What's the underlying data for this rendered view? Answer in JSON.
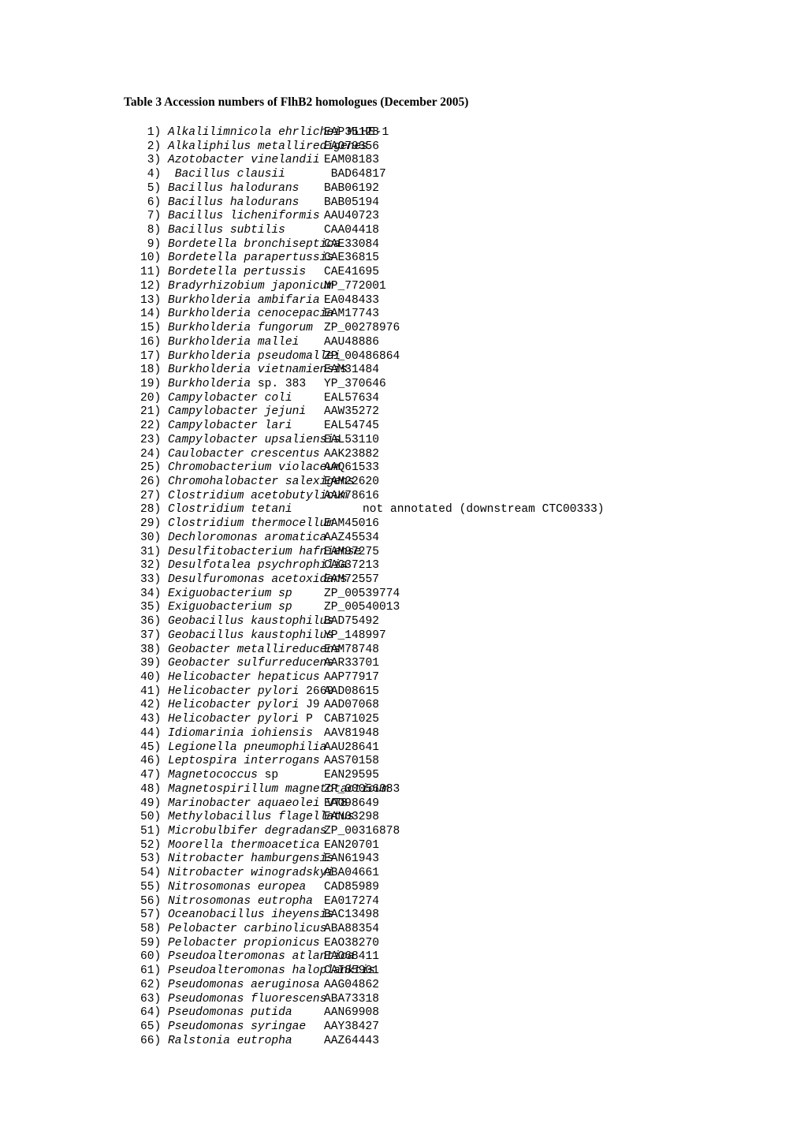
{
  "document": {
    "title": "Table 3 Accession numbers of FlhB2 homologues (December 2005)"
  },
  "table": {
    "entries": [
      {
        "index": "1)",
        "name": "Alkalilimnicola ehrlichei",
        "suffix": " MLHE-1",
        "accession": "EAP35128"
      },
      {
        "index": "2)",
        "name": "Alkaliphilus metalliredigenes",
        "suffix": "",
        "accession": "EAO79356"
      },
      {
        "index": "3)",
        "name": "Azotobacter vinelandii",
        "suffix": "",
        "accession": "EAM08183"
      },
      {
        "index": "4)",
        "name": " Bacillus clausii",
        "suffix": "",
        "accession": " BAD64817"
      },
      {
        "index": "5)",
        "name": "Bacillus halodurans",
        "suffix": "",
        "accession": "BAB06192"
      },
      {
        "index": "6)",
        "name": "Bacillus halodurans",
        "suffix": "",
        "accession": "BAB05194"
      },
      {
        "index": "7)",
        "name": "Bacillus licheniformis",
        "suffix": "",
        "accession": "AAU40723"
      },
      {
        "index": "8)",
        "name": "Bacillus subtilis",
        "suffix": "",
        "accession": "CAA04418"
      },
      {
        "index": "9)",
        "name": "Bordetella bronchiseptica",
        "suffix": "",
        "accession": "CAE33084"
      },
      {
        "index": "10)",
        "name": "Bordetella parapertussis",
        "suffix": "",
        "accession": "CAE36815"
      },
      {
        "index": "11)",
        "name": "Bordetella pertussis",
        "suffix": "",
        "accession": "CAE41695"
      },
      {
        "index": "12)",
        "name": "Bradyrhizobium japonicum",
        "suffix": "",
        "accession": "NP_772001"
      },
      {
        "index": "13)",
        "name": "Burkholderia ambifaria",
        "suffix": "",
        "accession": "EA048433"
      },
      {
        "index": "14)",
        "name": "Burkholderia cenocepacia",
        "suffix": "",
        "accession": "EAM17743"
      },
      {
        "index": "15)",
        "name": "Burkholderia fungorum",
        "suffix": "",
        "accession": "ZP_00278976"
      },
      {
        "index": "16)",
        "name": "Burkholderia mallei",
        "suffix": "",
        "accession": "AAU48886"
      },
      {
        "index": "17)",
        "name": "Burkholderia pseudomallei",
        "suffix": "",
        "accession": "ZP_00486864"
      },
      {
        "index": "18)",
        "name": "Burkholderia vietnamiensis",
        "suffix": "",
        "accession": "EAM31484"
      },
      {
        "index": "19)",
        "name": "Burkholderia",
        "suffix": " sp. 383",
        "accession": "YP_370646"
      },
      {
        "index": "20)",
        "name": "Campylobacter coli",
        "suffix": "",
        "accession": "EAL57634"
      },
      {
        "index": "21)",
        "name": "Campylobacter jejuni",
        "suffix": "",
        "accession": "AAW35272"
      },
      {
        "index": "22)",
        "name": "Campylobacter lari",
        "suffix": "",
        "accession": "EAL54745"
      },
      {
        "index": "23)",
        "name": "Campylobacter upsaliensis",
        "suffix": "",
        "accession": "EAL53110"
      },
      {
        "index": "24)",
        "name": "Caulobacter crescentus",
        "suffix": "",
        "accession": "AAK23882"
      },
      {
        "index": "25)",
        "name": "Chromobacterium violaceum",
        "suffix": "",
        "accession": "AAQ61533"
      },
      {
        "index": "26)",
        "name": "Chromohalobacter salexigens",
        "suffix": "",
        "accession": "EAM22620"
      },
      {
        "index": "27)",
        "name": "Clostridium acetobutylicum",
        "suffix": "",
        "accession": "AAK78616"
      },
      {
        "index": "28)",
        "name": "Clostridium tetani",
        "suffix": "",
        "accession": "",
        "note": "not annotated (downstream CTC00333)"
      },
      {
        "index": "29)",
        "name": "Clostridium thermocellum",
        "suffix": "",
        "accession": "EAM45016"
      },
      {
        "index": "30)",
        "name": "Dechloromonas aromatica",
        "suffix": "",
        "accession": "AAZ45534"
      },
      {
        "index": "31)",
        "name": "Desulfitobacterium hafniense",
        "suffix": "",
        "accession": "EAM97275"
      },
      {
        "index": "32)",
        "name": "Desulfotalea psychrophilia",
        "suffix": "",
        "accession": "CAG37213"
      },
      {
        "index": "33)",
        "name": "Desulfuromonas acetoxidans",
        "suffix": "",
        "accession": "EAM72557"
      },
      {
        "index": "34)",
        "name": "Exiguobacterium sp",
        "suffix": "",
        "accession": "ZP_00539774"
      },
      {
        "index": "35)",
        "name": "Exiguobacterium sp",
        "suffix": "",
        "accession": "ZP_00540013"
      },
      {
        "index": "36)",
        "name": "Geobacillus kaustophilus",
        "suffix": "",
        "accession": "BAD75492"
      },
      {
        "index": "37)",
        "name": "Geobacillus kaustophilus",
        "suffix": "",
        "accession": "YP_148997"
      },
      {
        "index": "38)",
        "name": "Geobacter metallireducens",
        "suffix": "",
        "accession": "EAM78748"
      },
      {
        "index": "39)",
        "name": "Geobacter sulfurreducens",
        "suffix": "",
        "accession": "AAR33701"
      },
      {
        "index": "40)",
        "name": "Helicobacter hepaticus",
        "suffix": "",
        "accession": "AAP77917"
      },
      {
        "index": "41)",
        "name": "Helicobacter pylori",
        "suffix": " 2669",
        "accession": "AAD08615"
      },
      {
        "index": "42)",
        "name": "Helicobacter pylori",
        "suffix": " J9",
        "accession": "AAD07068"
      },
      {
        "index": "43)",
        "name": "Helicobacter pylori",
        "suffix": " P",
        "accession": "CAB71025"
      },
      {
        "index": "44)",
        "name": "Idiomarinia iohiensis",
        "suffix": "",
        "accession": "AAV81948"
      },
      {
        "index": "45)",
        "name": "Legionella pneumophilia",
        "suffix": "",
        "accession": "AAU28641"
      },
      {
        "index": "46)",
        "name": "Leptospira interrogans",
        "suffix": "",
        "accession": "AAS70158"
      },
      {
        "index": "47)",
        "name": "Magnetococcus",
        "suffix": " sp",
        "accession": "EAN29595"
      },
      {
        "index": "48)",
        "name": "Magnetospirillum magnetotacticum",
        "suffix": "",
        "accession": "ZP_00056383"
      },
      {
        "index": "49)",
        "name": "Marinobacter aquaeolei",
        "suffix": " VT8",
        "accession": "EAO98649"
      },
      {
        "index": "50)",
        "name": "Methylobacillus flagellatus",
        "suffix": "",
        "accession": "EAN03298"
      },
      {
        "index": "51)",
        "name": "Microbulbifer degradans",
        "suffix": "",
        "accession": "ZP_00316878"
      },
      {
        "index": "52)",
        "name": "Moorella thermoacetica",
        "suffix": "",
        "accession": "EAN20701"
      },
      {
        "index": "53)",
        "name": "Nitrobacter hamburgensis",
        "suffix": "",
        "accession": "EAN61943"
      },
      {
        "index": "54)",
        "name": "Nitrobacter winogradskyi",
        "suffix": "",
        "accession": "ABA04661"
      },
      {
        "index": "55)",
        "name": "Nitrosomonas europea",
        "suffix": "",
        "accession": "CAD85989"
      },
      {
        "index": "56)",
        "name": "Nitrosomonas eutropha",
        "suffix": "",
        "accession": "EA017274"
      },
      {
        "index": "57)",
        "name": "Oceanobacillus iheyensis",
        "suffix": "",
        "accession": "BAC13498"
      },
      {
        "index": "58)",
        "name": "Pelobacter carbinolicus",
        "suffix": "",
        "accession": "ABA88354"
      },
      {
        "index": "59)",
        "name": "Pelobacter propionicus",
        "suffix": "",
        "accession": "EAO38270"
      },
      {
        "index": "60)",
        "name": "Pseudoalteromonas atlantica",
        "suffix": "",
        "accession": "EAO68411"
      },
      {
        "index": "61)",
        "name": "Pseudoalteromonas haloplanktis",
        "suffix": "",
        "accession": "CAI85901"
      },
      {
        "index": "62)",
        "name": "Pseudomonas aeruginosa",
        "suffix": "",
        "accession": "AAG04862"
      },
      {
        "index": "63)",
        "name": "Pseudomonas fluorescens",
        "suffix": "",
        "accession": "ABA73318"
      },
      {
        "index": "64)",
        "name": "Pseudomonas putida",
        "suffix": "",
        "accession": "AAN69908"
      },
      {
        "index": "65)",
        "name": "Pseudomonas syringae",
        "suffix": "",
        "accession": "AAY38427"
      },
      {
        "index": "66)",
        "name": "Ralstonia eutropha",
        "suffix": "",
        "accession": "AAZ64443"
      }
    ]
  }
}
